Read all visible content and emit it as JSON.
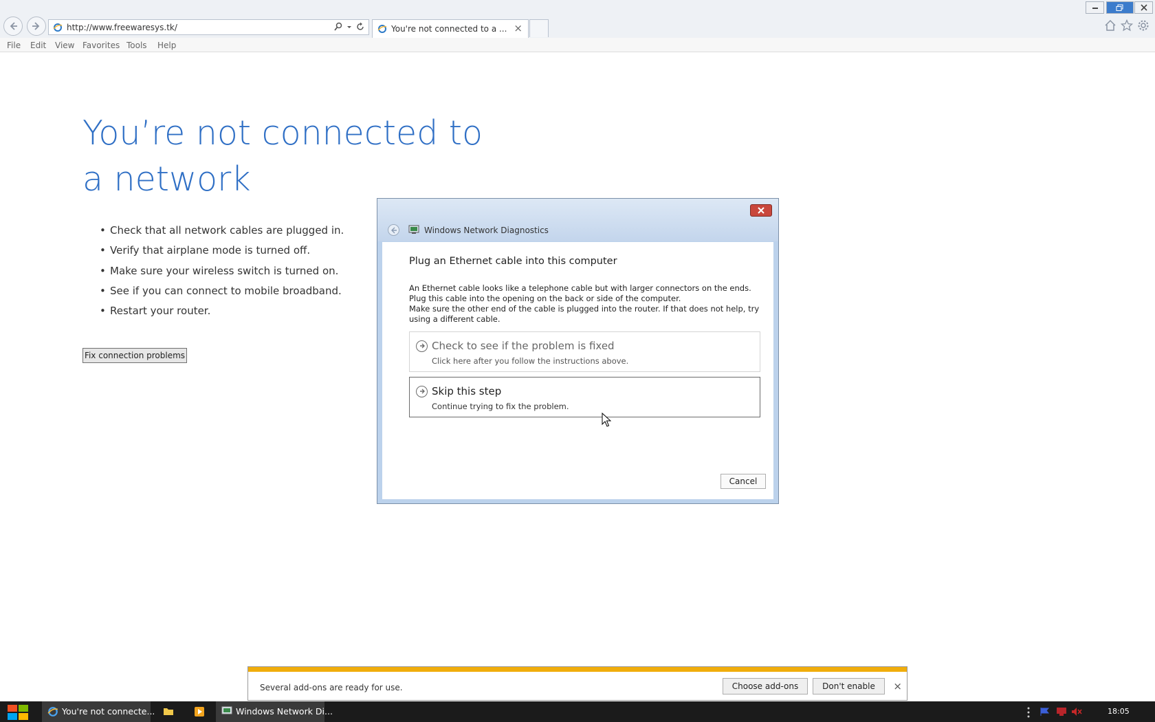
{
  "browser": {
    "url": "http://www.freewaresys.tk/",
    "tab_title": "You're not connected to a ...",
    "menu": [
      "File",
      "Edit",
      "View",
      "Favorites",
      "Tools",
      "Help"
    ]
  },
  "page": {
    "title": "You’re not connected to a network",
    "bullets": [
      "Check that all network cables are plugged in.",
      "Verify that airplane mode is turned off.",
      "Make sure your wireless switch is turned on.",
      "See if you can connect to mobile broadband.",
      "Restart your router."
    ],
    "fix_button": "Fix connection problems"
  },
  "dialog": {
    "app_title": "Windows Network Diagnostics",
    "heading": "Plug an Ethernet cable into this computer",
    "description_1": "An Ethernet cable looks like a telephone cable but with larger connectors on the ends. Plug this cable into the opening on the back or side of the computer.",
    "description_2": "Make sure the other end of the cable is plugged into the router. If that does not help, try using a different cable.",
    "options": [
      {
        "title": "Check to see if the problem is fixed",
        "subtitle": "Click here after you follow the instructions above."
      },
      {
        "title": "Skip this step",
        "subtitle": "Continue trying to fix the problem."
      }
    ],
    "cancel": "Cancel"
  },
  "notification": {
    "message": "Several add-ons are ready for use.",
    "choose_button": "Choose add-ons",
    "dont_enable_button": "Don't enable",
    "close": "×"
  },
  "taskbar": {
    "items": [
      "You're not connecte...",
      "Windows Network Di..."
    ],
    "clock": "18:05"
  },
  "colors": {
    "title_blue": "#2f6fc5",
    "notification_stripe": "#f0ad0c"
  }
}
